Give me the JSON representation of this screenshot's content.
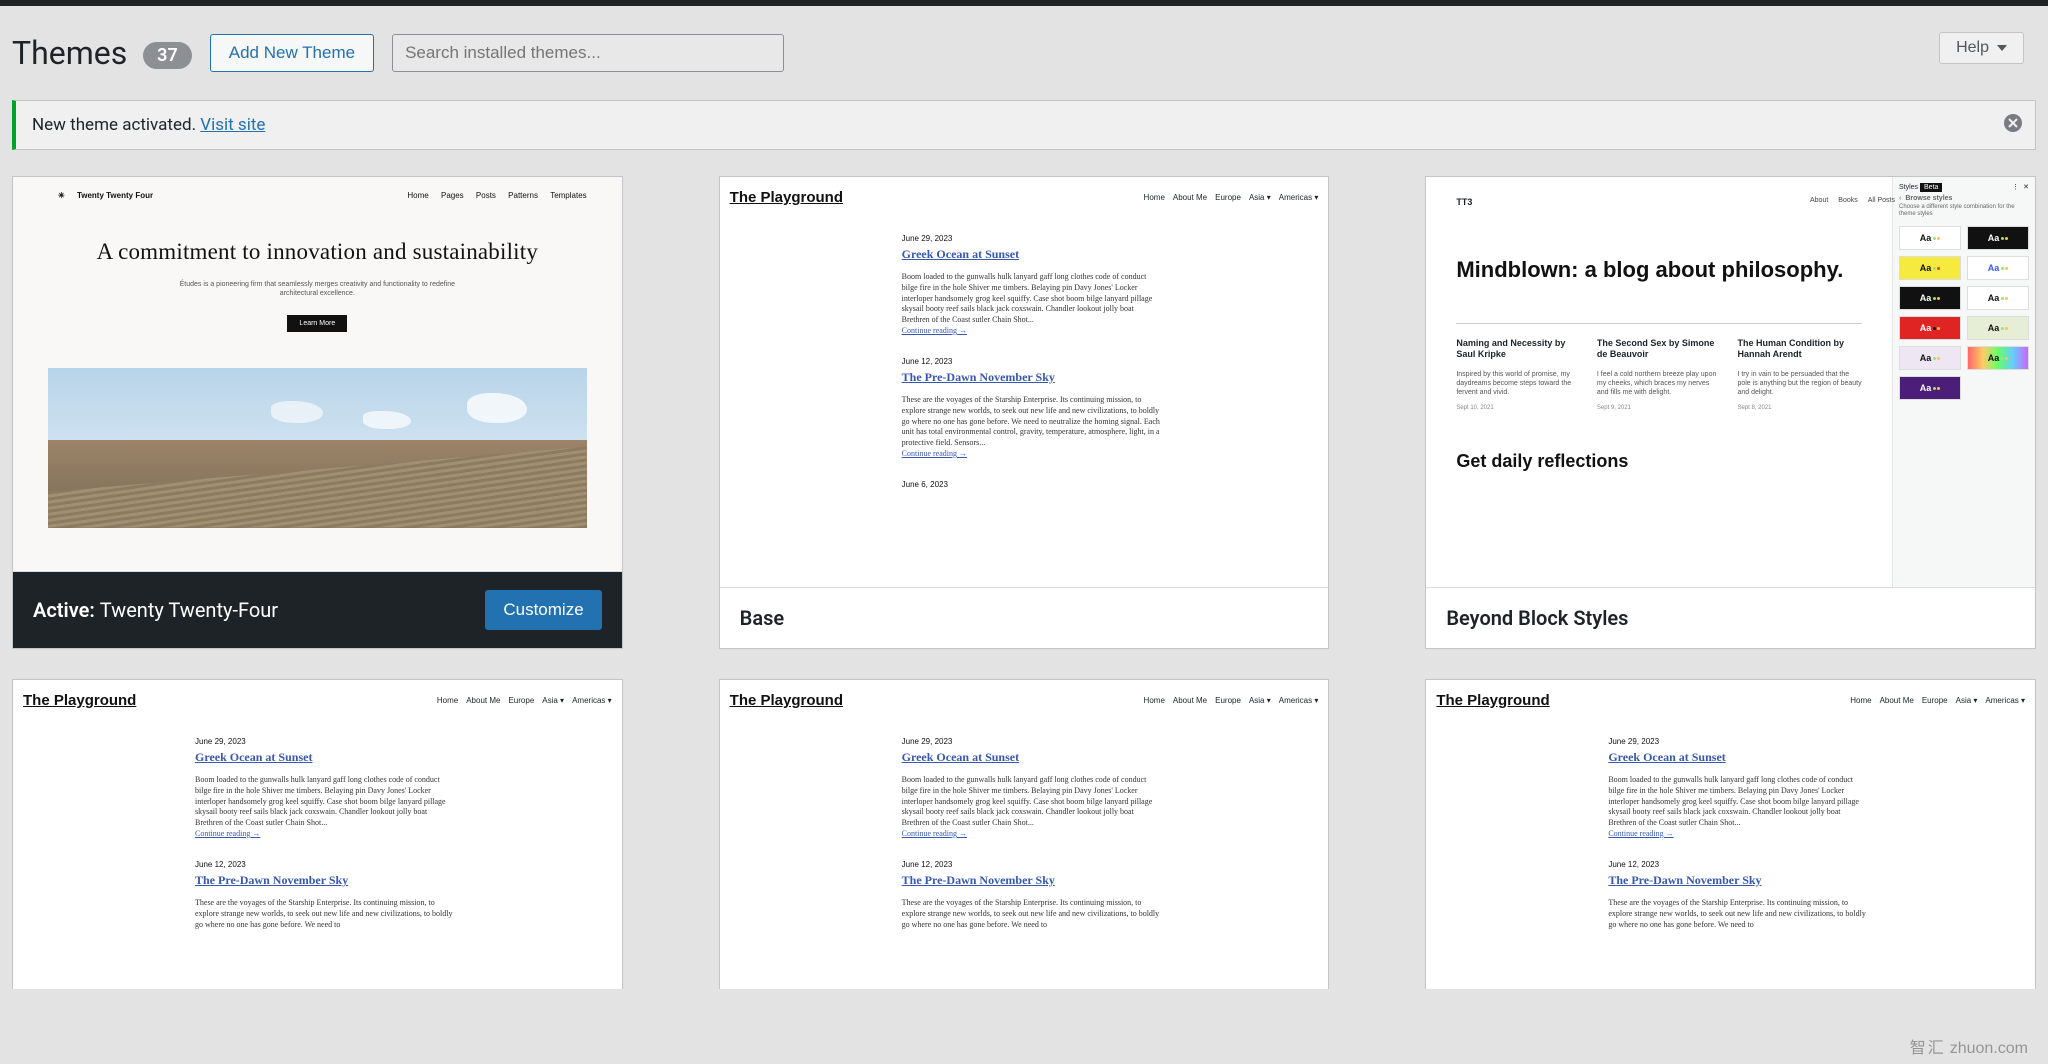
{
  "header": {
    "title": "Themes",
    "count": "37",
    "add_new": "Add New Theme",
    "search_placeholder": "Search installed themes...",
    "help": "Help"
  },
  "notice": {
    "text": "New theme activated. ",
    "link": "Visit site"
  },
  "themes": [
    {
      "active": true,
      "active_label": "Active:",
      "name": "Twenty Twenty-Four",
      "customize": "Customize",
      "preview": {
        "site": "Twenty Twenty Four",
        "nav": [
          "Home",
          "Pages",
          "Posts",
          "Patterns",
          "Templates"
        ],
        "headline": "A commitment to innovation and sustainability",
        "sub": "Études is a pioneering firm that seamlessly merges creativity and functionality to redefine architectural excellence.",
        "cta": "Learn More"
      }
    },
    {
      "name": "Base",
      "preview": {
        "site": "The Playground",
        "nav": [
          "Home",
          "About Me",
          "Europe",
          "Asia ▾",
          "Americas ▾"
        ],
        "posts": [
          {
            "date": "June 29, 2023",
            "title": "Greek Ocean at Sunset",
            "excerpt": "Boom loaded to the gunwalls hulk lanyard gaff long clothes code of conduct bilge fire in the hole Shiver me timbers. Belaying pin Davy Jones' Locker interloper handsomely grog keel squiffy. Case shot boom bilge lanyard pillage skysail booty reef sails black jack coxswain. Chandler lookout jolly boat Brethren of the Coast sutler Chain Shot...",
            "more": "Continue reading →"
          },
          {
            "date": "June 12, 2023",
            "title": "The Pre-Dawn November Sky",
            "excerpt": "These are the voyages of the Starship Enterprise. Its continuing mission, to explore strange new worlds, to seek out new life and new civilizations, to boldly go where no one has gone before. We need to neutralize the homing signal. Each unit has total environmental control, gravity, temperature, atmosphere, light, in a protective field. Sensors...",
            "more": "Continue reading →"
          },
          {
            "date": "June 6, 2023"
          }
        ]
      }
    },
    {
      "name": "Beyond Block Styles",
      "preview": {
        "logo": "TT3",
        "nav": [
          "About",
          "Books",
          "All Posts"
        ],
        "hero": "Mindblown: a blog about philosophy.",
        "cols": [
          {
            "t": "Naming and Necessity by Saul Kripke",
            "d": "Inspired by this world of promise, my daydreams become steps toward the fervent and vivid.",
            "dt": "Sept 10, 2021"
          },
          {
            "t": "The Second Sex by Simone de Beauvoir",
            "d": "I feel a cold northern breeze play upon my cheeks, which braces my nerves and fills me with delight.",
            "dt": "Sept 9, 2021"
          },
          {
            "t": "The Human Condition by Hannah Arendt",
            "d": "I try in vain to be persuaded that the pole is anything but the region of beauty and delight.",
            "dt": "Sept 8, 2021"
          }
        ],
        "cta": "Get daily reflections",
        "panel": {
          "tabs": [
            "Styles",
            "Beta"
          ],
          "sub": "Browse styles",
          "desc": "Choose a different style combination for the theme styles",
          "swatches": [
            {
              "bg": "#ffffff",
              "fg": "#111",
              "d1": "#9ae66e",
              "d2": "#f7c948"
            },
            {
              "bg": "#111111",
              "fg": "#fff",
              "d1": "#9ae66e",
              "d2": "#f7c948"
            },
            {
              "bg": "#f5ea3d",
              "fg": "#111",
              "d1": "#9ae66e",
              "d2": "#d44"
            },
            {
              "bg": "#ffffff",
              "fg": "#3858e9",
              "d1": "#9ae66e",
              "d2": "#f7c948"
            },
            {
              "bg": "#111111",
              "fg": "#fff",
              "d1": "#9ae66e",
              "d2": "#f7c948"
            },
            {
              "bg": "#ffffff",
              "fg": "#111",
              "d1": "#9ae66e",
              "d2": "#f7c948"
            },
            {
              "bg": "#e02424",
              "fg": "#fff",
              "d1": "#111",
              "d2": "#f7c948"
            },
            {
              "bg": "#e6efd5",
              "fg": "#111",
              "d1": "#9ae66e",
              "d2": "#f7c948"
            },
            {
              "bg": "#eee6f3",
              "fg": "#111",
              "d1": "#9ae66e",
              "d2": "#f7c948"
            },
            {
              "bg": "#f0f7ee",
              "fg": "#111",
              "d1": "#9ae66e",
              "d2": "#f7c948",
              "rainbow": true
            },
            {
              "bg": "#4b1e7a",
              "fg": "#fff",
              "d1": "#9ae66e",
              "d2": "#f7c948"
            }
          ]
        }
      }
    }
  ],
  "row2": {
    "preview": {
      "site": "The Playground",
      "nav": [
        "Home",
        "About Me",
        "Europe",
        "Asia ▾",
        "Americas ▾"
      ],
      "posts": [
        {
          "date": "June 29, 2023",
          "title": "Greek Ocean at Sunset",
          "excerpt": "Boom loaded to the gunwalls hulk lanyard gaff long clothes code of conduct bilge fire in the hole Shiver me timbers. Belaying pin Davy Jones' Locker interloper handsomely grog keel squiffy. Case shot boom bilge lanyard pillage skysail booty reef sails black jack coxswain. Chandler lookout jolly boat Brethren of the Coast sutler Chain Shot...",
          "more": "Continue reading →"
        },
        {
          "date": "June 12, 2023",
          "title": "The Pre-Dawn November Sky",
          "excerpt": "These are the voyages of the Starship Enterprise. Its continuing mission, to explore strange new worlds, to seek out new life and new civilizations, to boldly go where no one has gone before. We need to"
        }
      ]
    }
  },
  "watermark": {
    "cn": "智汇",
    "latin": "zhuon.com"
  }
}
